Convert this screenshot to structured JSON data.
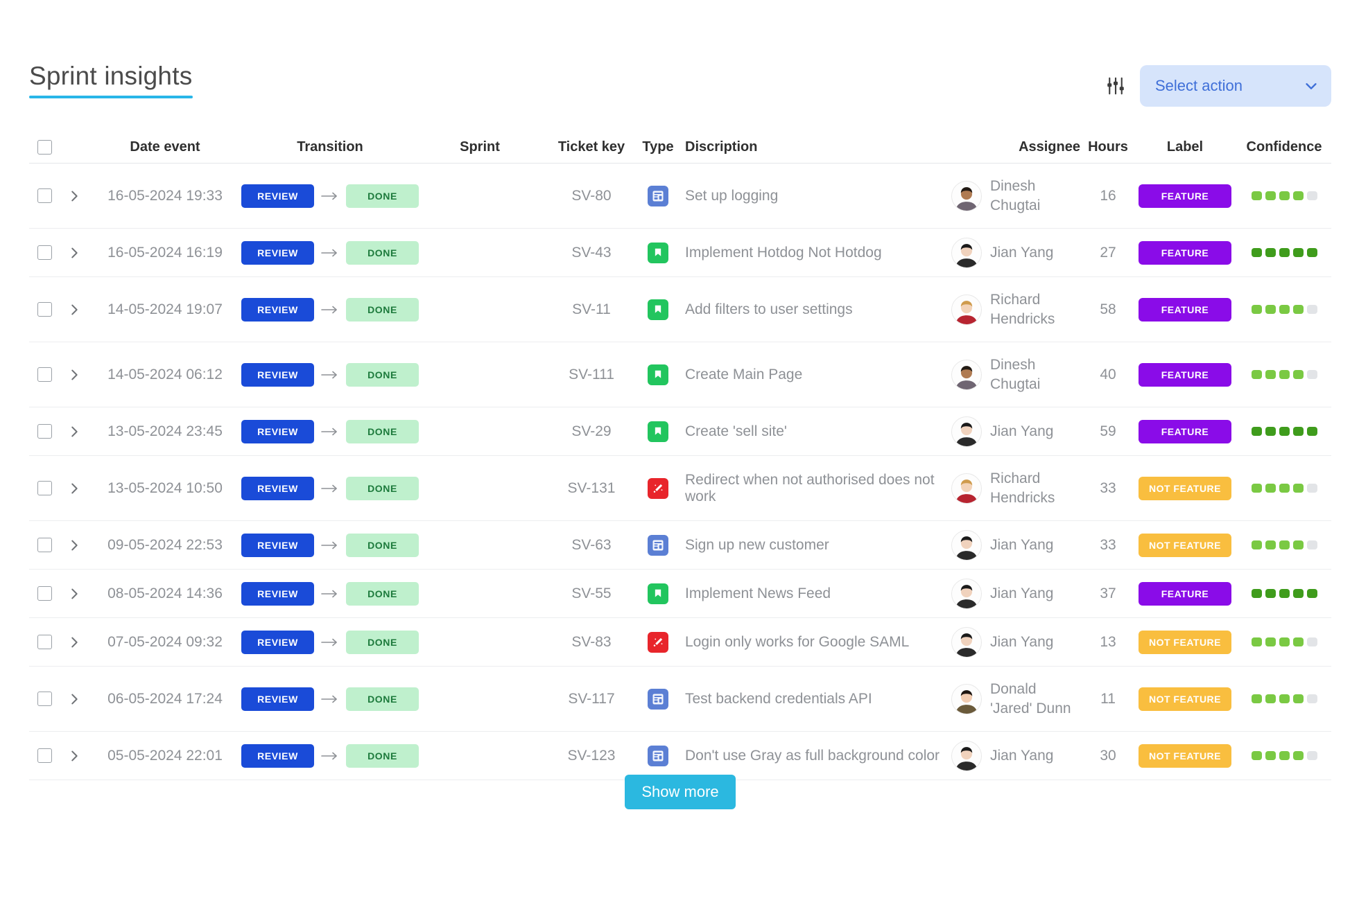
{
  "header": {
    "title": "Sprint insights",
    "sliders_icon": "sliders-icon",
    "select_action_label": "Select action",
    "chevron_icon": "chevron-down-icon",
    "accent_underline_color": "#29b6e8",
    "select_bg_color": "#d6e4fb",
    "select_text_color": "#3f6fd8"
  },
  "table": {
    "columns": [
      {
        "key": "select",
        "label": ""
      },
      {
        "key": "expand",
        "label": ""
      },
      {
        "key": "date",
        "label": "Date event"
      },
      {
        "key": "transition",
        "label": "Transition"
      },
      {
        "key": "sprint",
        "label": "Sprint"
      },
      {
        "key": "ticket_key",
        "label": "Ticket key"
      },
      {
        "key": "type",
        "label": "Type"
      },
      {
        "key": "description",
        "label": "Discription"
      },
      {
        "key": "assignee",
        "label": "Assignee"
      },
      {
        "key": "hours",
        "label": "Hours"
      },
      {
        "key": "label",
        "label": "Label"
      },
      {
        "key": "confidence",
        "label": "Confidence"
      }
    ],
    "transition_from": "REVIEW",
    "transition_to": "DONE",
    "colors": {
      "from_bg": "#1a4bd8",
      "from_text": "#ffffff",
      "to_bg": "#bff0cd",
      "to_text": "#1d7a3c",
      "feature_bg": "#8a0ce8",
      "not_feature_bg": "#f9be3f",
      "dot_on": "#7ac943",
      "dot_on_full": "#3f9c1c",
      "dot_off": "#e2e4e7",
      "type_task": "#5b7fd4",
      "type_story": "#22c55e",
      "type_bug": "#e8252b"
    },
    "rows": [
      {
        "date": "16-05-2024 19:33",
        "sprint": "",
        "ticket_key": "SV-80",
        "type": "task",
        "description": "Set up logging",
        "assignee": "Dinesh Chugtai",
        "avatar": "dinesh",
        "hours": "16",
        "label": "FEATURE",
        "confidence": 4,
        "two_line": true
      },
      {
        "date": "16-05-2024 16:19",
        "sprint": "",
        "ticket_key": "SV-43",
        "type": "story",
        "description": "Implement Hotdog Not Hotdog",
        "assignee": "Jian Yang",
        "avatar": "jian",
        "hours": "27",
        "label": "FEATURE",
        "confidence": 5,
        "two_line": false
      },
      {
        "date": "14-05-2024 19:07",
        "sprint": "",
        "ticket_key": "SV-11",
        "type": "story",
        "description": "Add filters to user settings",
        "assignee": "Richard Hendricks",
        "avatar": "richard",
        "hours": "58",
        "label": "FEATURE",
        "confidence": 4,
        "two_line": true
      },
      {
        "date": "14-05-2024 06:12",
        "sprint": "",
        "ticket_key": "SV-111",
        "type": "story",
        "description": "Create Main Page",
        "assignee": "Dinesh Chugtai",
        "avatar": "dinesh",
        "hours": "40",
        "label": "FEATURE",
        "confidence": 4,
        "two_line": true
      },
      {
        "date": "13-05-2024 23:45",
        "sprint": "",
        "ticket_key": "SV-29",
        "type": "story",
        "description": "Create 'sell site'",
        "assignee": "Jian Yang",
        "avatar": "jian",
        "hours": "59",
        "label": "FEATURE",
        "confidence": 5,
        "two_line": false
      },
      {
        "date": "13-05-2024 10:50",
        "sprint": "",
        "ticket_key": "SV-131",
        "type": "bug",
        "description": "Redirect when not authorised does not work",
        "assignee": "Richard Hendricks",
        "avatar": "richard",
        "hours": "33",
        "label": "NOT FEATURE",
        "confidence": 4,
        "two_line": true
      },
      {
        "date": "09-05-2024 22:53",
        "sprint": "",
        "ticket_key": "SV-63",
        "type": "task",
        "description": "Sign up new customer",
        "assignee": "Jian Yang",
        "avatar": "jian",
        "hours": "33",
        "label": "NOT FEATURE",
        "confidence": 4,
        "two_line": false
      },
      {
        "date": "08-05-2024 14:36",
        "sprint": "",
        "ticket_key": "SV-55",
        "type": "story",
        "description": "Implement News Feed",
        "assignee": "Jian Yang",
        "avatar": "jian",
        "hours": "37",
        "label": "FEATURE",
        "confidence": 5,
        "two_line": false
      },
      {
        "date": "07-05-2024 09:32",
        "sprint": "",
        "ticket_key": "SV-83",
        "type": "bug",
        "description": "Login only works for Google SAML",
        "assignee": "Jian Yang",
        "avatar": "jian",
        "hours": "13",
        "label": "NOT FEATURE",
        "confidence": 4,
        "two_line": false
      },
      {
        "date": "06-05-2024 17:24",
        "sprint": "",
        "ticket_key": "SV-117",
        "type": "task",
        "description": "Test backend credentials API",
        "assignee": "Donald 'Jared' Dunn",
        "avatar": "donald",
        "hours": "11",
        "label": "NOT FEATURE",
        "confidence": 4,
        "two_line": true
      },
      {
        "date": "05-05-2024 22:01",
        "sprint": "",
        "ticket_key": "SV-123",
        "type": "task",
        "description": "Don't use Gray as full background color",
        "assignee": "Jian Yang",
        "avatar": "jian",
        "hours": "30",
        "label": "NOT FEATURE",
        "confidence": 4,
        "two_line": false
      }
    ]
  },
  "footer": {
    "show_more_label": "Show more",
    "show_more_color": "#2bb8e0"
  }
}
